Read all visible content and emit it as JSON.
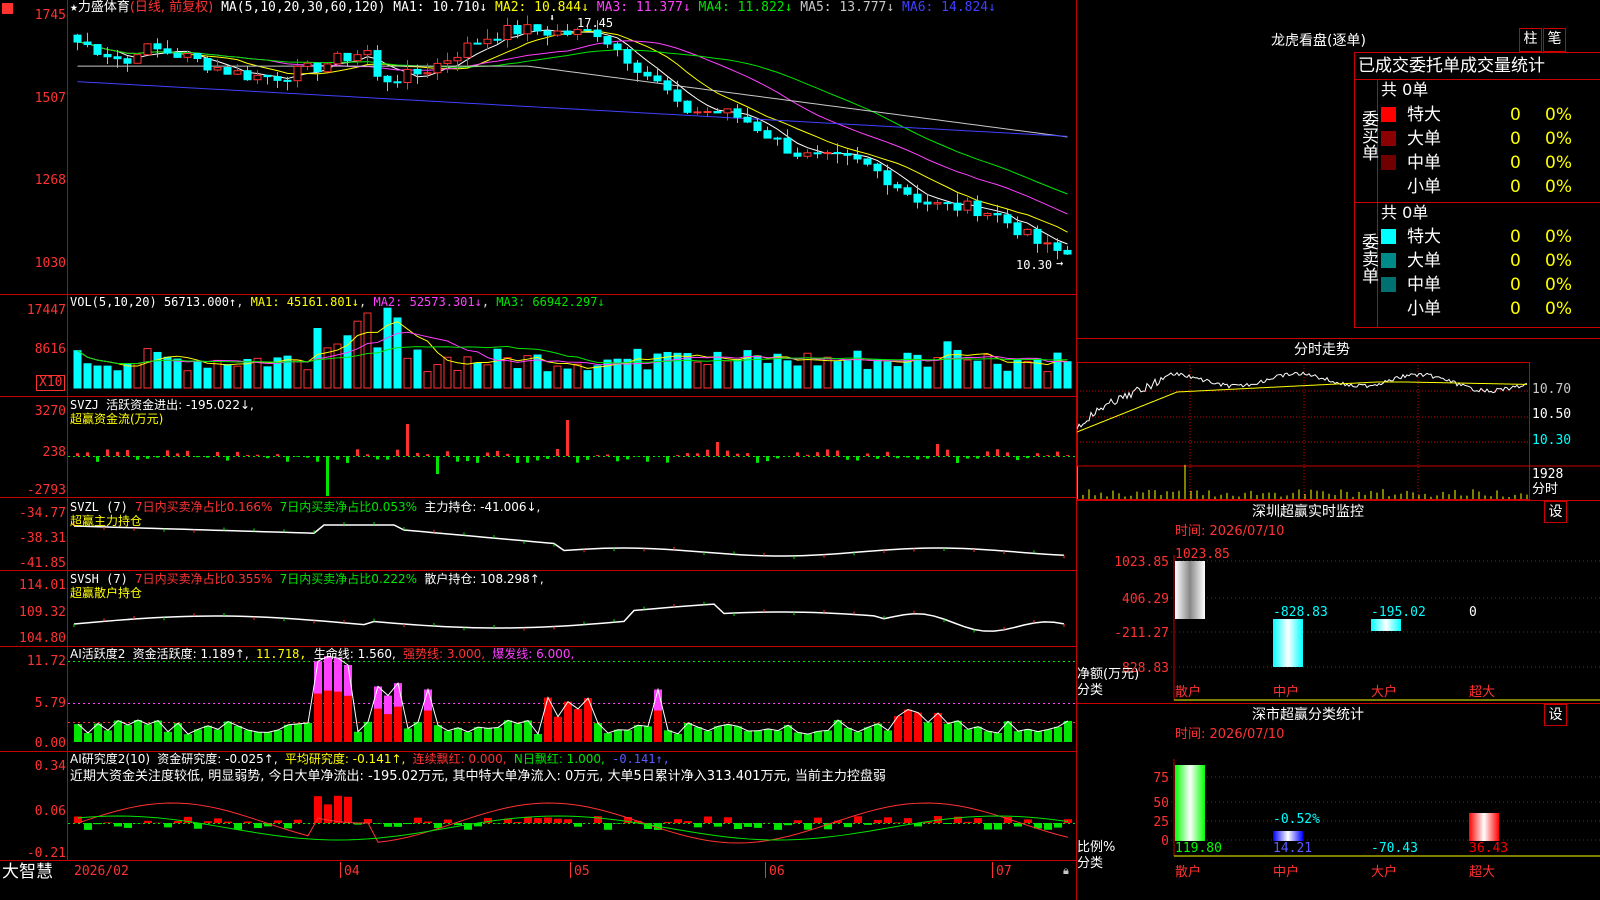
{
  "stock": {
    "name": "力盛体育",
    "period": "(日线, 前复权)"
  },
  "main": {
    "ma_label": "MA(5,10,20,30,60,120)",
    "ma": [
      {
        "name": "MA1:",
        "value": "10.710↓",
        "color": "#ffffff"
      },
      {
        "name": "MA2:",
        "value": "10.844↓",
        "color": "#ffff00"
      },
      {
        "name": "MA3:",
        "value": "11.377↓",
        "color": "#ff40ff"
      },
      {
        "name": "MA4:",
        "value": "11.822↓",
        "color": "#00e600"
      },
      {
        "name": "MA5:",
        "value": "13.777↓",
        "color": "#c8c8c8"
      },
      {
        "name": "MA6:",
        "value": "14.824↓",
        "color": "#4040ff"
      }
    ],
    "yaxis": [
      "1745",
      "1507",
      "1268",
      "1030"
    ],
    "high_label": "17.45",
    "low_label": "10.30"
  },
  "vol": {
    "label": "VOL(5,10,20)",
    "value": "56713.000↑",
    "ma1": "MA1: 45161.801↓",
    "ma2": "MA2: 52573.301↓",
    "ma3": "MA3: 66942.297↓",
    "yaxis": [
      "17447",
      "8616"
    ],
    "unit": "X10"
  },
  "svzj": {
    "label": "SVZJ",
    "title": "活跃资金进出: -195.022↓,",
    "subtitle": "超赢资金流(万元)",
    "yaxis": [
      "3270",
      "238",
      "-2793"
    ]
  },
  "svzl": {
    "label": "SVZL (7)",
    "v1": "7日内买卖净占比0.166%",
    "v2": "7日内买卖净占比0.053%",
    "v3": "主力持仓: -41.006↓,",
    "subtitle": "超赢主力持仓",
    "yaxis": [
      "-34.77",
      "-38.31",
      "-41.85"
    ]
  },
  "svsh": {
    "label": "SVSH (7)",
    "v1": "7日内买卖净占比0.355%",
    "v2": "7日内买卖净占比0.222%",
    "v3": "散户持仓: 108.298↑,",
    "subtitle": "超赢散户持仓",
    "yaxis": [
      "114.01",
      "109.32",
      "104.80"
    ]
  },
  "ai1": {
    "label": "AI活跃度2",
    "v1": "资金活跃度: 1.189↑,",
    "v2": "11.718,",
    "v3": "生命线: 1.560,",
    "v4": "强势线: 3.000,",
    "v5": "爆发线: 6.000,",
    "yaxis": [
      "11.72",
      "5.79",
      "0.00"
    ]
  },
  "ai2": {
    "label": "AI研究度2(10)",
    "v1": "资金研究度: -0.025↑,",
    "v2": "平均研究度: -0.141↑,",
    "v3": "连续飘红: 0.000,",
    "v4": "N日飘红: 1.000,",
    "v5": "-0.141↑,",
    "desc": "近期大资金关注度较低, 明显弱势, 今日大单净流出: -195.02万元, 其中特大单净流入: 0万元, 大单5日累计净入313.401万元, 当前主力控盘弱",
    "yaxis": [
      "0.34",
      "0.06",
      "-0.21"
    ]
  },
  "timeaxis": {
    "app": "大智慧",
    "labels": [
      "2026/02",
      "04",
      "05",
      "06",
      "07"
    ]
  },
  "lhb": {
    "title": "龙虎看盘(逐单)",
    "btn1": "柱",
    "btn2": "笔",
    "header": "已成交委托单成交量统计",
    "buy": {
      "side": "委买单",
      "total": "共 0单",
      "rows": [
        {
          "name": "特大",
          "count": "0",
          "pct": "0%",
          "color": "#ff0000"
        },
        {
          "name": "大单",
          "count": "0",
          "pct": "0%",
          "color": "#8b0000"
        },
        {
          "name": "中单",
          "count": "0",
          "pct": "0%",
          "color": "#700000"
        },
        {
          "name": "小单",
          "count": "0",
          "pct": "0%",
          "color": "#000000"
        }
      ]
    },
    "sell": {
      "side": "委卖单",
      "total": "共 0单",
      "rows": [
        {
          "name": "特大",
          "count": "0",
          "pct": "0%",
          "color": "#00ffff"
        },
        {
          "name": "大单",
          "count": "0",
          "pct": "0%",
          "color": "#008b8b"
        },
        {
          "name": "中单",
          "count": "0",
          "pct": "0%",
          "color": "#007070"
        },
        {
          "name": "小单",
          "count": "0",
          "pct": "0%",
          "color": "#000000"
        }
      ]
    }
  },
  "fenshi": {
    "title": "分时走势",
    "yaxis": [
      "10.70",
      "10.50",
      "10.30"
    ],
    "vol_label": "1928",
    "unit": "分时"
  },
  "sz_monitor": {
    "title": "深圳超赢实时监控",
    "btn": "设",
    "time": "时间: 2026/07/10",
    "ylabels": [
      "1023.85",
      "406.29",
      "-211.27",
      "-828.83"
    ],
    "unit": "净额(万元)",
    "cat_label": "分类",
    "categories": [
      "散户",
      "中户",
      "大户",
      "超大"
    ],
    "values": [
      "1023.85",
      "-828.83",
      "-195.02",
      "0"
    ]
  },
  "sz_class": {
    "title": "深市超赢分类统计",
    "btn": "设",
    "time": "时间: 2026/07/10",
    "ylabels": [
      "75",
      "50",
      "25",
      "0"
    ],
    "unit": "比例%",
    "cat_label": "分类",
    "categories": [
      "散户",
      "中户",
      "大户",
      "超大"
    ],
    "values": [
      "119.80",
      "14.21",
      "-70.43",
      "36.43"
    ],
    "extra_label": "-0.52%"
  },
  "colors": {
    "up": "#ff3232",
    "down": "#00ffff",
    "border": "#c80000",
    "bg": "#000000"
  }
}
